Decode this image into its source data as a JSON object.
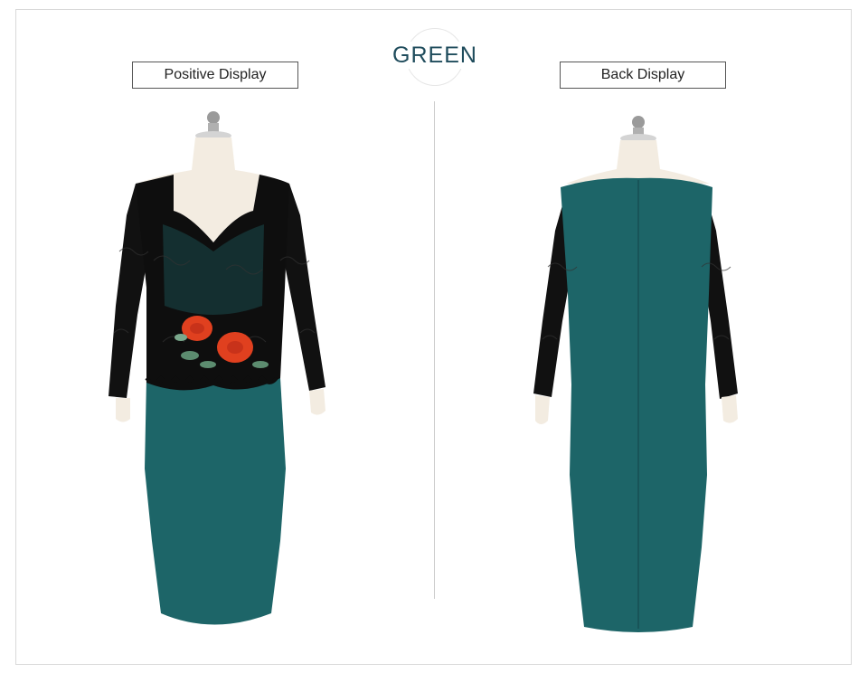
{
  "color_title": "GREEN",
  "labels": {
    "front": "Positive Display",
    "back": "Back Display"
  },
  "colors": {
    "dress_teal": "#1d6568",
    "dress_teal_dark": "#174f52",
    "lace_black": "#0d0d0d",
    "mannequin_skin": "#f3ece1",
    "flower_red": "#e0401f",
    "leaf_green": "#5c8c6f",
    "title_color": "#1f4c5c"
  },
  "icons": {
    "front_view": "mannequin-front-dress-image",
    "back_view": "mannequin-back-dress-image"
  }
}
